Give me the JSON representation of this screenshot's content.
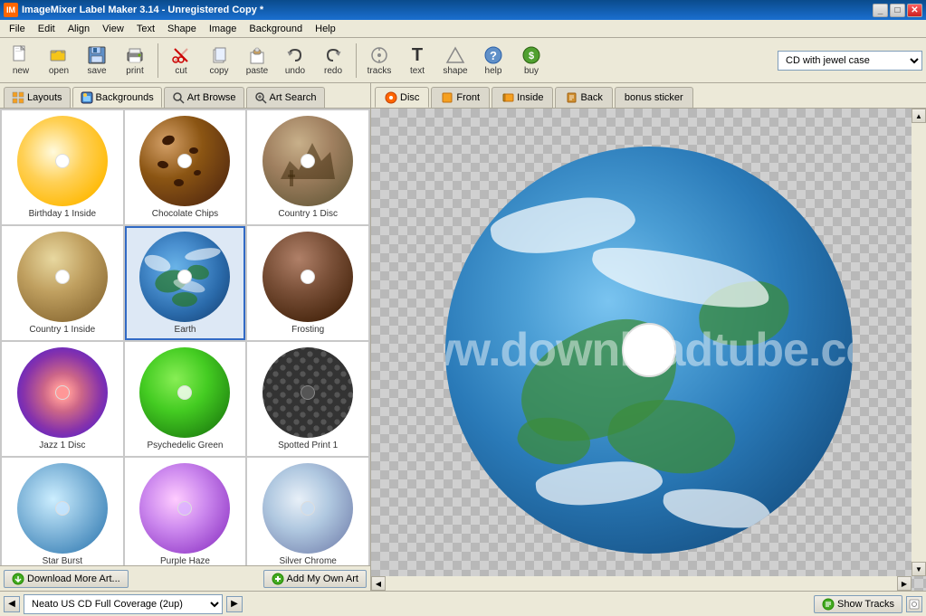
{
  "titlebar": {
    "title": "ImageMixer Label Maker 3.14 - Unregistered Copy *",
    "icon": "IM",
    "buttons": [
      "minimize",
      "maximize",
      "close"
    ]
  },
  "menubar": {
    "items": [
      "File",
      "Edit",
      "Align",
      "View",
      "Text",
      "Shape",
      "Image",
      "Background",
      "Help"
    ]
  },
  "toolbar": {
    "tools": [
      {
        "id": "new",
        "label": "new",
        "icon": "📄"
      },
      {
        "id": "open",
        "label": "open",
        "icon": "📂"
      },
      {
        "id": "save",
        "label": "save",
        "icon": "💾"
      },
      {
        "id": "print",
        "label": "print",
        "icon": "🖨"
      },
      {
        "id": "cut",
        "label": "cut",
        "icon": "✂"
      },
      {
        "id": "copy",
        "label": "copy",
        "icon": "📋"
      },
      {
        "id": "paste",
        "label": "paste",
        "icon": "📌"
      },
      {
        "id": "undo",
        "label": "undo",
        "icon": "↩"
      },
      {
        "id": "redo",
        "label": "redo",
        "icon": "↪"
      },
      {
        "id": "tracks",
        "label": "tracks",
        "icon": "🎵"
      },
      {
        "id": "text",
        "label": "text",
        "icon": "T"
      },
      {
        "id": "shape",
        "label": "shape",
        "icon": "⬡"
      },
      {
        "id": "help",
        "label": "help",
        "icon": "?"
      },
      {
        "id": "buy",
        "label": "buy",
        "icon": "🛒"
      }
    ],
    "template_label": "CD with jewel case"
  },
  "panel_tabs": [
    {
      "id": "layouts",
      "label": "Layouts",
      "icon": "🗂",
      "active": false
    },
    {
      "id": "backgrounds",
      "label": "Backgrounds",
      "icon": "🖼",
      "active": true
    },
    {
      "id": "art_browse",
      "label": "Art Browse",
      "icon": "🔍",
      "active": false
    },
    {
      "id": "art_search",
      "label": "Art Search",
      "icon": "🔎",
      "active": false
    }
  ],
  "thumbnails": [
    {
      "id": "birthday1",
      "label": "Birthday 1 Inside",
      "style": "birthday"
    },
    {
      "id": "chocolate",
      "label": "Chocolate Chips",
      "style": "chocolate"
    },
    {
      "id": "country1disc",
      "label": "Country 1 Disc",
      "style": "country"
    },
    {
      "id": "country-inside",
      "label": "Country 1 Inside",
      "style": "country-inside"
    },
    {
      "id": "earth",
      "label": "Earth",
      "style": "earth",
      "selected": true
    },
    {
      "id": "frosting",
      "label": "Frosting",
      "style": "frosting"
    },
    {
      "id": "jazz",
      "label": "Jazz 1 Disc",
      "style": "jazz"
    },
    {
      "id": "psychedelic",
      "label": "Psychedelic Green",
      "style": "psychedelic"
    },
    {
      "id": "spotted",
      "label": "Spotted Print 1",
      "style": "spotted"
    },
    {
      "id": "extra1",
      "label": "Star Burst",
      "style": "extra1"
    },
    {
      "id": "extra2",
      "label": "Purple Haze",
      "style": "extra2"
    },
    {
      "id": "extra3",
      "label": "Silver Chrome",
      "style": "extra3"
    }
  ],
  "panel_bottom": {
    "download_label": "Download More Art...",
    "add_label": "Add My Own Art"
  },
  "view_tabs": [
    {
      "id": "disc",
      "label": "Disc",
      "active": true
    },
    {
      "id": "front",
      "label": "Front",
      "active": false
    },
    {
      "id": "inside",
      "label": "Inside",
      "active": false
    },
    {
      "id": "back",
      "label": "Back",
      "active": false
    },
    {
      "id": "bonus",
      "label": "bonus sticker",
      "active": false
    }
  ],
  "watermark": {
    "line1": "www.downloadtube.com"
  },
  "statusbar": {
    "layout_label": "Neato US CD Full Coverage (2up)",
    "show_tracks_label": "Show Tracks"
  }
}
